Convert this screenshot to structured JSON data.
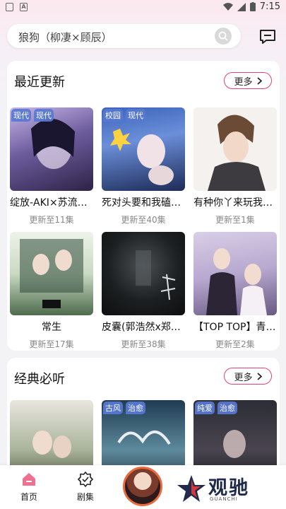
{
  "status_bar": {
    "time": "7:15",
    "left_icons": [
      "notification-square-icon",
      "a-square-icon"
    ],
    "right_icons": [
      "wifi-icon",
      "signal-icon",
      "battery-icon"
    ]
  },
  "search": {
    "query": "狼狗（柳凄×顾辰）",
    "icon": "search-icon"
  },
  "header": {
    "message_icon": "message-icon"
  },
  "sections": {
    "recent": {
      "title": "最近更新",
      "more": "更多",
      "items": [
        {
          "tags": [
            "现代",
            "现代"
          ],
          "title": "绽放-AKI×苏流…",
          "sub": "更新至11集"
        },
        {
          "tags": [
            "校园",
            "现代"
          ],
          "title": "死对头要和我磕…",
          "sub": "更新至40集"
        },
        {
          "tags": [],
          "title": "有种你丫来玩我…",
          "sub": "更新至1集"
        },
        {
          "tags": [],
          "title": "常生",
          "sub": "更新至17集"
        },
        {
          "tags": [],
          "title": "皮囊(郭浩然x郑…",
          "sub": "更新至38集"
        },
        {
          "tags": [],
          "title": "【TOP TOP】青…",
          "sub": "更新至2集"
        }
      ]
    },
    "classic": {
      "title": "经典必听",
      "more": "更多",
      "items": [
        {
          "tags": []
        },
        {
          "tags": [
            "古风",
            "治愈"
          ]
        },
        {
          "tags": [
            "纯爱",
            "治愈"
          ]
        }
      ]
    }
  },
  "nav": {
    "home": "首页",
    "drama": "剧集"
  },
  "watermark": {
    "text": "观驰",
    "sub": "GUANCHI"
  },
  "colors": {
    "accent": "#e2436f",
    "tag_bg": "#5878d2"
  }
}
